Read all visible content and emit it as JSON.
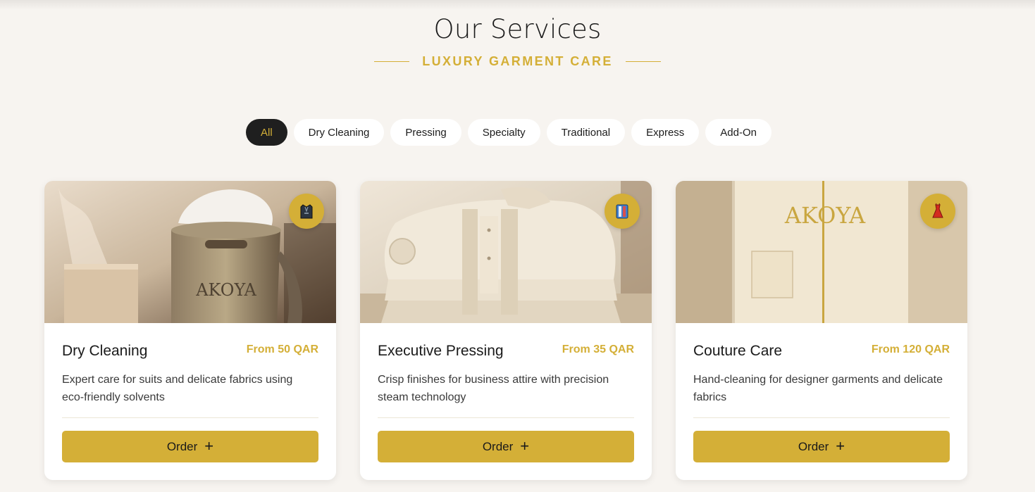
{
  "header": {
    "title": "Our Services",
    "subtitle": "LUXURY GARMENT CARE"
  },
  "filters": [
    "All",
    "Dry Cleaning",
    "Pressing",
    "Specialty",
    "Traditional",
    "Express",
    "Add-On"
  ],
  "active_filter": "All",
  "cards": [
    {
      "name": "Dry Cleaning",
      "price": "From 50 QAR",
      "description": "Expert care for suits and delicate fabrics using eco-friendly solvents",
      "order_label": "Order",
      "badge_icon": "suit-icon",
      "image_text": "AKOYA"
    },
    {
      "name": "Executive Pressing",
      "price": "From 35 QAR",
      "description": "Crisp finishes for business attire with precision steam technology",
      "order_label": "Order",
      "badge_icon": "shirt-icon"
    },
    {
      "name": "Couture Care",
      "price": "From 120 QAR",
      "description": "Hand-cleaning for designer garments and delicate fabrics",
      "order_label": "Order",
      "badge_icon": "dress-icon",
      "image_text": "AKOYA"
    }
  ],
  "colors": {
    "gold": "#d4af37",
    "dark": "#1f1f1f",
    "background": "#f7f4f0"
  }
}
